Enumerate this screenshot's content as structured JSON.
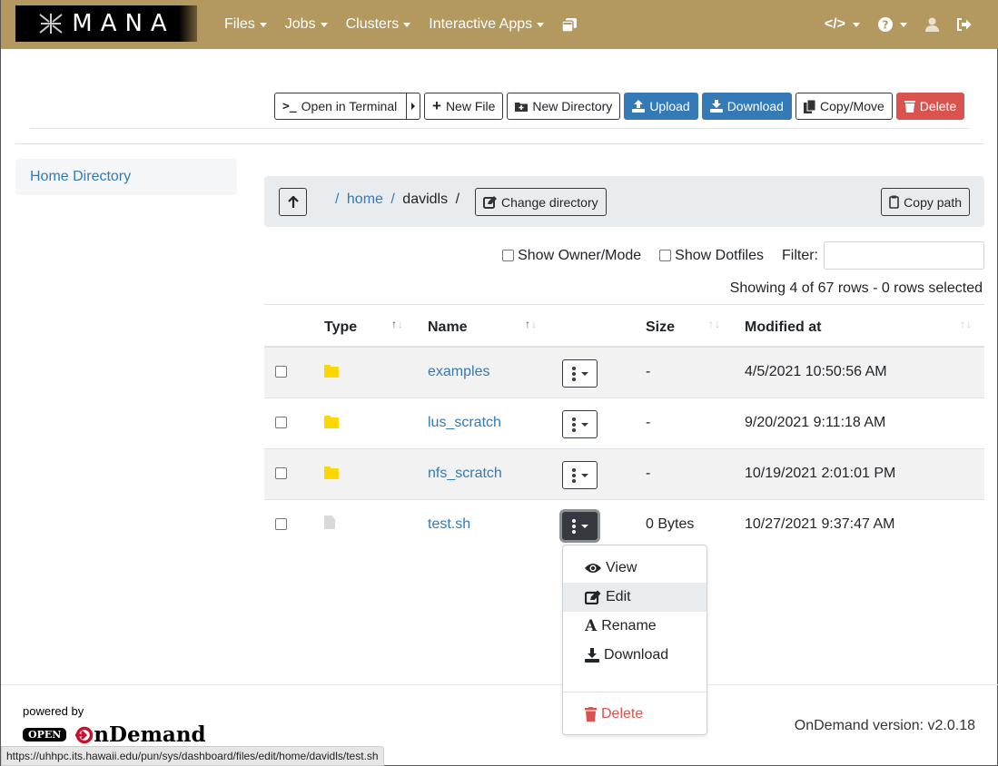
{
  "navbar": {
    "brand": "MANA",
    "items": [
      {
        "label": "Files",
        "has_caret": true
      },
      {
        "label": "Jobs",
        "has_caret": true
      },
      {
        "label": "Clusters",
        "has_caret": true
      },
      {
        "label": "Interactive Apps",
        "has_caret": true
      }
    ],
    "right_icons": [
      "develop-code-icon",
      "help-icon",
      "user-icon",
      "logout-icon"
    ],
    "background_color": "#b3985f"
  },
  "toolbar": {
    "open_terminal": "Open in Terminal",
    "new_file": "New File",
    "new_directory": "New Directory",
    "upload": "Upload",
    "download": "Download",
    "copy_move": "Copy/Move",
    "delete": "Delete"
  },
  "sidebar": {
    "items": [
      {
        "label": "Home Directory"
      }
    ]
  },
  "breadcrumb": {
    "root_sep": "/",
    "parts": [
      {
        "label": "home",
        "link": true
      },
      {
        "label": "davidls",
        "link": false
      }
    ],
    "sep": "/",
    "change_directory": "Change directory",
    "copy_path": "Copy path"
  },
  "filters": {
    "show_owner_mode": "Show Owner/Mode",
    "show_owner_mode_checked": false,
    "show_dotfiles": "Show Dotfiles",
    "show_dotfiles_checked": false,
    "filter_label": "Filter:",
    "filter_value": ""
  },
  "status": {
    "showing": "Showing 4 of 67 rows - 0 rows selected"
  },
  "table": {
    "columns": [
      "Type",
      "Name",
      "Size",
      "Modified at"
    ],
    "rows": [
      {
        "type": "folder",
        "name": "examples",
        "size": "-",
        "modified": "4/5/2021 10:50:56 AM"
      },
      {
        "type": "folder",
        "name": "lus_scratch",
        "size": "-",
        "modified": "9/20/2021 9:11:18 AM"
      },
      {
        "type": "folder",
        "name": "nfs_scratch",
        "size": "-",
        "modified": "10/19/2021 2:01:01 PM"
      },
      {
        "type": "file",
        "name": "test.sh",
        "size": "0 Bytes",
        "modified": "10/27/2021 9:37:47 AM"
      }
    ]
  },
  "context_menu": {
    "items": [
      {
        "label": "View",
        "icon": "eye-icon"
      },
      {
        "label": "Edit",
        "icon": "edit-icon",
        "hovered": true
      },
      {
        "label": "Rename",
        "icon": "rename-icon"
      },
      {
        "label": "Download",
        "icon": "download-icon"
      },
      {
        "label": "Delete",
        "icon": "trash-icon",
        "danger": true
      }
    ]
  },
  "footer": {
    "powered_by": "powered by",
    "logo_open": "OPEN",
    "logo_ondemand_rest": "nDemand",
    "version": "OnDemand version: v2.0.18"
  },
  "status_bar": {
    "url": "https://uhhpc.its.hawaii.edu/pun/sys/dashboard/files/edit/home/davidls/test.sh"
  }
}
